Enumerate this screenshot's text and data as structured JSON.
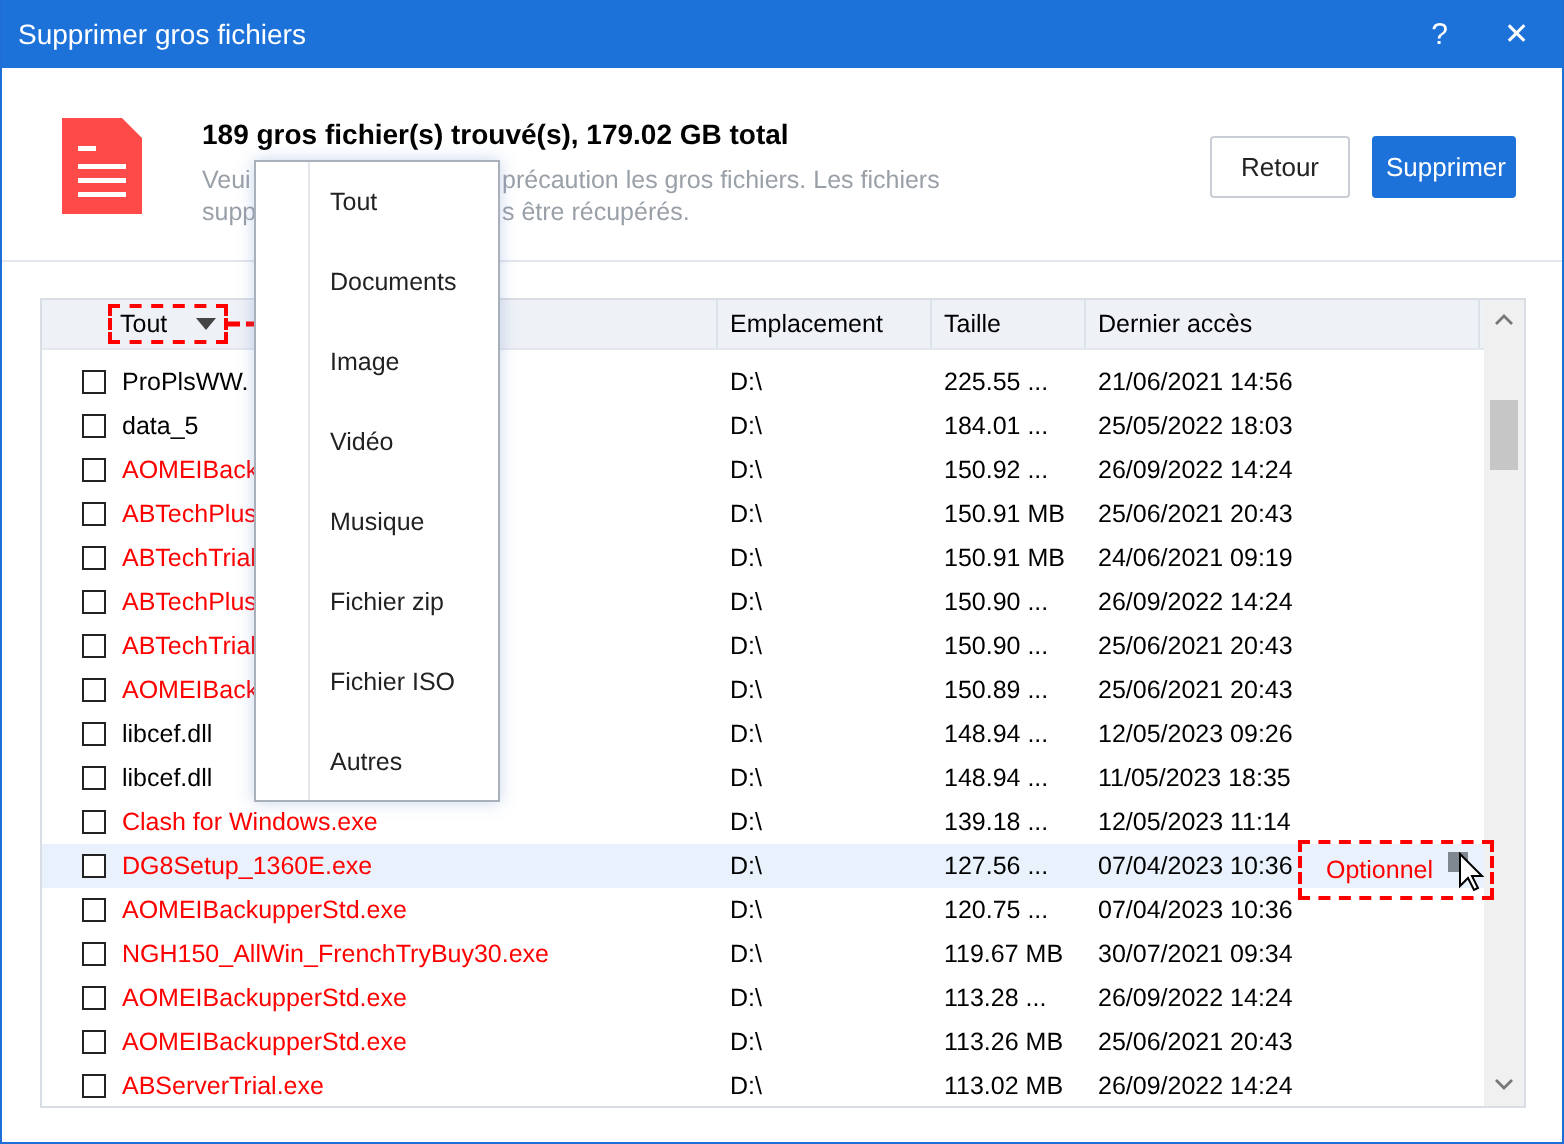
{
  "window": {
    "title": "Supprimer gros fichiers",
    "help": "?",
    "close": "✕"
  },
  "summary": {
    "title": "189 gros fichier(s) trouvé(s),  179.02 GB total",
    "description_lines": [
      {
        "left": "Veui",
        "right": "précaution les gros fichiers. Les fichiers"
      },
      {
        "left": "supp",
        "right": "s être récupérés."
      }
    ]
  },
  "buttons": [
    {
      "label": "Retour",
      "kind": "secondary"
    },
    {
      "label": "Supprimer",
      "kind": "primary"
    }
  ],
  "filter": {
    "label": "Tout",
    "expanded": true
  },
  "filter_menu": [
    "Tout",
    "Documents",
    "Image",
    "Vidéo",
    "Musique",
    "Fichier zip",
    "Fichier ISO",
    "Autres"
  ],
  "table": {
    "columns": [
      "Emplacement",
      "Taille",
      "Dernier accès"
    ],
    "rows": [
      {
        "name": "ProPlsWW.",
        "location": "D:\\",
        "size": "225.55 ...",
        "accessed": "21/06/2021 14:56",
        "color": "#000000",
        "checked": false,
        "highlighted": false
      },
      {
        "name": "data_5",
        "location": "D:\\",
        "size": "184.01 ...",
        "accessed": "25/05/2022 18:03",
        "color": "#000000",
        "checked": false,
        "highlighted": false
      },
      {
        "name": "AOMEIBack",
        "location": "D:\\",
        "size": "150.92 ...",
        "accessed": "26/09/2022 14:24",
        "color": "#ff0000",
        "checked": false,
        "highlighted": false
      },
      {
        "name": "ABTechPlus",
        "location": "D:\\",
        "size": "150.91 MB",
        "accessed": "25/06/2021 20:43",
        "color": "#ff0000",
        "checked": false,
        "highlighted": false
      },
      {
        "name": "ABTechTrial",
        "location": "D:\\",
        "size": "150.91 MB",
        "accessed": "24/06/2021 09:19",
        "color": "#ff0000",
        "checked": false,
        "highlighted": false
      },
      {
        "name": "ABTechPlus",
        "location": "D:\\",
        "size": "150.90 ...",
        "accessed": "26/09/2022 14:24",
        "color": "#ff0000",
        "checked": false,
        "highlighted": false
      },
      {
        "name": "ABTechTrial",
        "location": "D:\\",
        "size": "150.90 ...",
        "accessed": "25/06/2021 20:43",
        "color": "#ff0000",
        "checked": false,
        "highlighted": false
      },
      {
        "name": "AOMEIBack",
        "location": "D:\\",
        "size": "150.89 ...",
        "accessed": "25/06/2021 20:43",
        "color": "#ff0000",
        "checked": false,
        "highlighted": false
      },
      {
        "name": "libcef.dll",
        "location": "D:\\",
        "size": "148.94 ...",
        "accessed": "12/05/2023 09:26",
        "color": "#000000",
        "checked": false,
        "highlighted": false
      },
      {
        "name": "libcef.dll",
        "location": "D:\\",
        "size": "148.94 ...",
        "accessed": "11/05/2023 18:35",
        "color": "#000000",
        "checked": false,
        "highlighted": false
      },
      {
        "name": "Clash for Windows.exe",
        "location": "D:\\",
        "size": "139.18 ...",
        "accessed": "12/05/2023 11:14",
        "color": "#ff0000",
        "checked": false,
        "highlighted": false
      },
      {
        "name": "DG8Setup_1360E.exe",
        "location": "D:\\",
        "size": "127.56 ...",
        "accessed": "07/04/2023 10:36",
        "color": "#ff0000",
        "checked": false,
        "highlighted": true
      },
      {
        "name": "AOMEIBackupperStd.exe",
        "location": "D:\\",
        "size": "120.75 ...",
        "accessed": "07/04/2023 10:36",
        "color": "#ff0000",
        "checked": false,
        "highlighted": false
      },
      {
        "name": "NGH150_AllWin_FrenchTryBuy30.exe",
        "location": "D:\\",
        "size": "119.67 MB",
        "accessed": "30/07/2021 09:34",
        "color": "#ff0000",
        "checked": false,
        "highlighted": false
      },
      {
        "name": "AOMEIBackupperStd.exe",
        "location": "D:\\",
        "size": "113.28 ...",
        "accessed": "26/09/2022 14:24",
        "color": "#ff0000",
        "checked": false,
        "highlighted": false
      },
      {
        "name": "AOMEIBackupperStd.exe",
        "location": "D:\\",
        "size": "113.26 MB",
        "accessed": "25/06/2021 20:43",
        "color": "#ff0000",
        "checked": false,
        "highlighted": false
      },
      {
        "name": "ABServerTrial.exe",
        "location": "D:\\",
        "size": "113.02 MB",
        "accessed": "26/09/2022 14:24",
        "color": "#ff0000",
        "checked": false,
        "highlighted": false
      }
    ]
  },
  "callout": {
    "label": "Optionnel"
  }
}
